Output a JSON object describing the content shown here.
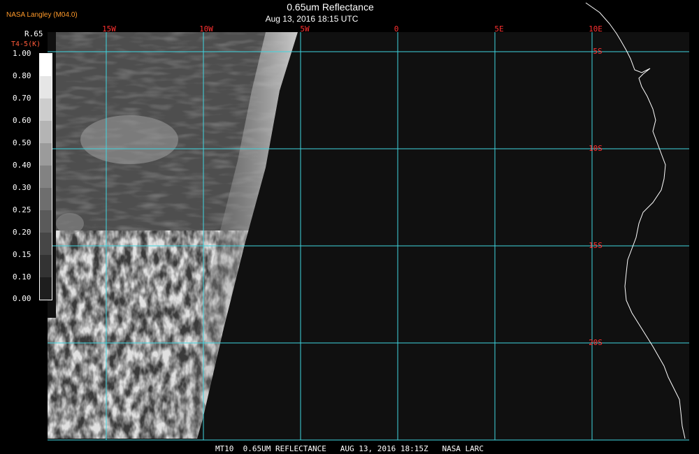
{
  "header": {
    "producer": "NASA Langley (M04.0)",
    "title": "0.65um Reflectance",
    "subtitle": "Aug 13, 2016 18:15 UTC"
  },
  "colorbar": {
    "label": "R.65",
    "sublabel": "T4-5(K)",
    "ticks": [
      "1.00",
      "0.80",
      "0.70",
      "0.60",
      "0.50",
      "0.40",
      "0.30",
      "0.25",
      "0.20",
      "0.15",
      "0.10",
      "0.00"
    ]
  },
  "map": {
    "lon_labels": [
      "15W",
      "10W",
      "5W",
      "0",
      "5E",
      "10E"
    ],
    "lat_labels": [
      "5S",
      "10S",
      "15S",
      "20S"
    ],
    "grid_color": "#3fd6e0",
    "label_color": "#ff3030",
    "coast_color": "#ffffff"
  },
  "footer": {
    "text": "MT10  0.65UM REFLECTANCE   AUG 13, 2016 18:15Z   NASA LARC"
  }
}
